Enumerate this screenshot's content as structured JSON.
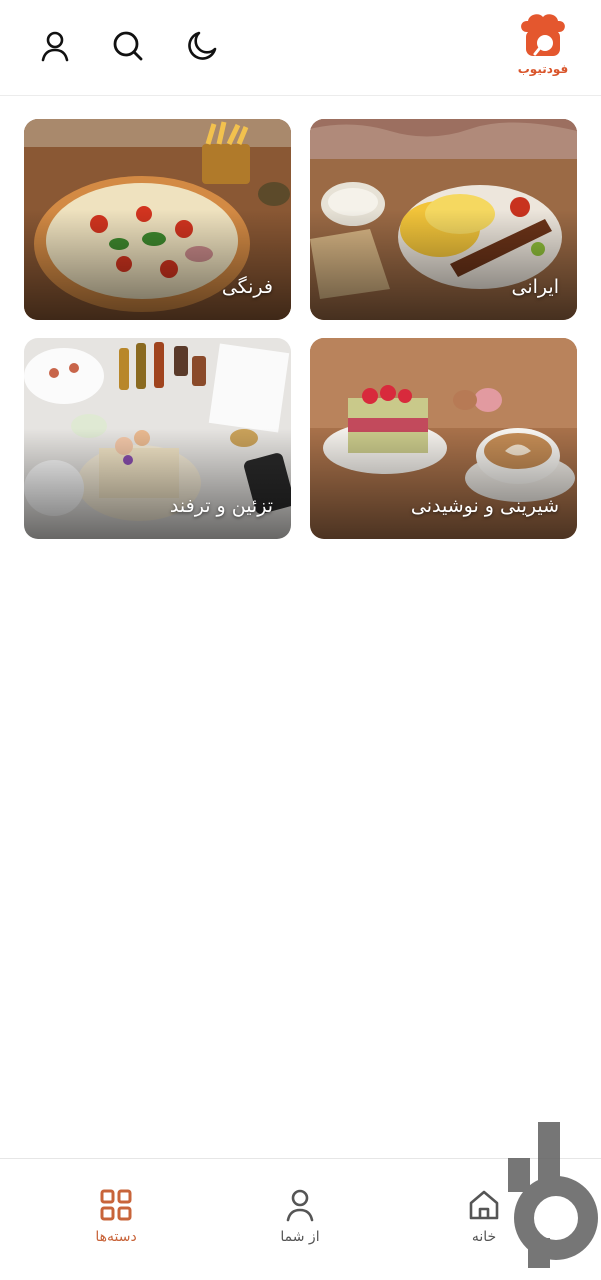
{
  "app": {
    "logo_text": "فودتیوب",
    "accent": "#e4572e"
  },
  "header": {
    "icons": [
      "profile-icon",
      "search-icon",
      "moon-icon"
    ]
  },
  "categories": [
    {
      "label": "ایرانی"
    },
    {
      "label": "فرنگی"
    },
    {
      "label": "شیرینی و نوشیدنی"
    },
    {
      "label": "تزئین و ترفند"
    }
  ],
  "bottom_nav": {
    "items": [
      {
        "label": "خانه",
        "icon": "home-icon"
      },
      {
        "label": "از شما",
        "icon": "person-icon"
      },
      {
        "label": "دسته‌ها",
        "icon": "grid-icon",
        "active": true
      }
    ],
    "active_color": "#c8643a"
  }
}
